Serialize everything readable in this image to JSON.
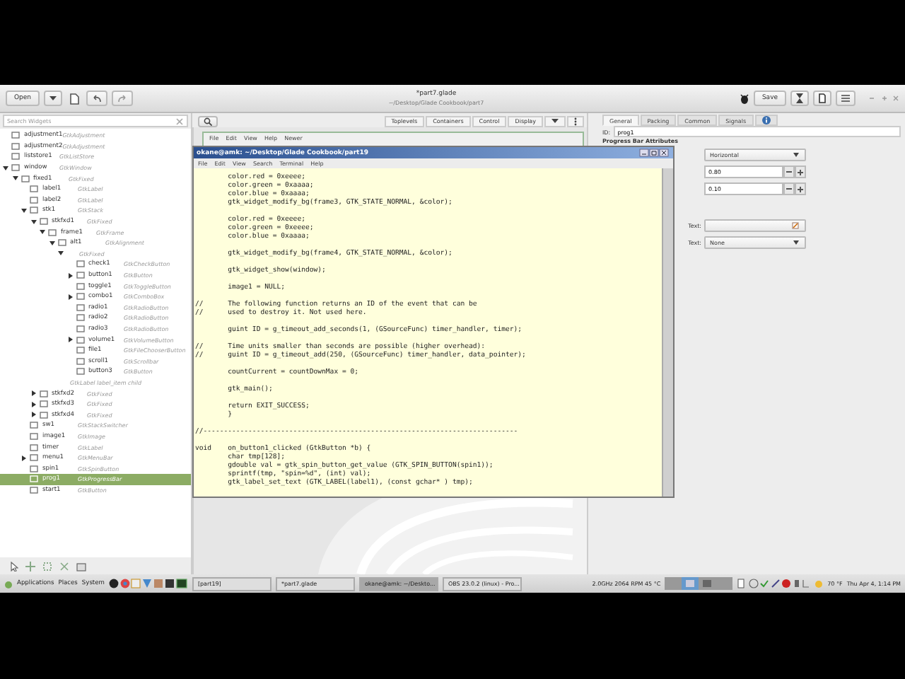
{
  "header": {
    "open_button": "Open",
    "title": "*part7.glade",
    "subtitle": "~/Desktop/Glade Cookbook/part7",
    "save_button": "Save"
  },
  "widget_search": {
    "placeholder": "Search Widgets"
  },
  "tree": [
    {
      "name": "adjustment1",
      "type": "GtkAdjustment",
      "kind": "leaf",
      "selected": false
    },
    {
      "name": "adjustment2",
      "type": "GtkAdjustment",
      "kind": "leaf",
      "selected": false
    },
    {
      "name": "liststore1",
      "type": "GtkListStore",
      "kind": "leaf",
      "selected": false
    },
    {
      "name": "window",
      "type": "GtkWindow",
      "kind": "group",
      "expanded": true,
      "selected": false,
      "children": [
        {
          "name": "fixed1",
          "type": "GtkFixed",
          "kind": "group",
          "expanded": true,
          "selected": false,
          "children": [
            {
              "name": "label1",
              "type": "GtkLabel",
              "kind": "leaf",
              "selected": false
            },
            {
              "name": "label2",
              "type": "GtkLabel",
              "kind": "leaf",
              "selected": false
            },
            {
              "name": "stk1",
              "type": "GtkStack",
              "kind": "group",
              "expanded": true,
              "selected": false,
              "children": [
                {
                  "name": "stkfxd1",
                  "type": "GtkFixed",
                  "kind": "group",
                  "expanded": true,
                  "selected": false,
                  "children": [
                    {
                      "name": "frame1",
                      "type": "GtkFrame",
                      "kind": "group",
                      "expanded": true,
                      "selected": false,
                      "children": [
                        {
                          "name": "alt1",
                          "type": "GtkAlignment",
                          "kind": "group",
                          "expanded": true,
                          "selected": false,
                          "children": [
                            {
                              "type": "GtkFixed",
                              "kind": "group",
                              "expanded": true,
                              "selected": false,
                              "children": [
                                {
                                  "name": "check1",
                                  "type": "GtkCheckButton",
                                  "kind": "leaf",
                                  "selected": false
                                },
                                {
                                  "name": "button1",
                                  "type": "GtkButton",
                                  "kind": "group",
                                  "expanded": false,
                                  "selected": false
                                },
                                {
                                  "name": "toggle1",
                                  "type": "GtkToggleButton",
                                  "kind": "leaf",
                                  "selected": false
                                },
                                {
                                  "name": "combo1",
                                  "type": "GtkComboBox",
                                  "kind": "group",
                                  "expanded": false,
                                  "selected": false
                                },
                                {
                                  "name": "radio1",
                                  "type": "GtkRadioButton",
                                  "kind": "leaf",
                                  "selected": false
                                },
                                {
                                  "name": "radio2",
                                  "type": "GtkRadioButton",
                                  "kind": "leaf",
                                  "selected": false
                                },
                                {
                                  "name": "radio3",
                                  "type": "GtkRadioButton",
                                  "kind": "leaf",
                                  "selected": false
                                },
                                {
                                  "name": "volume1",
                                  "type": "GtkVolumeButton",
                                  "kind": "group",
                                  "expanded": false,
                                  "selected": false
                                },
                                {
                                  "name": "file1",
                                  "type": "GtkFileChooserButton",
                                  "kind": "leaf",
                                  "selected": false
                                },
                                {
                                  "name": "scroll1",
                                  "type": "GtkScrollbar",
                                  "kind": "leaf",
                                  "selected": false
                                },
                                {
                                  "name": "button3",
                                  "type": "GtkButton",
                                  "kind": "leaf",
                                  "selected": false
                                }
                              ]
                            }
                          ]
                        },
                        {
                          "type": "GtkLabel label_item child",
                          "kind": "leaf",
                          "selected": false
                        }
                      ]
                    }
                  ]
                },
                {
                  "name": "stkfxd2",
                  "type": "GtkFixed",
                  "kind": "group",
                  "expanded": false,
                  "selected": false
                },
                {
                  "name": "stkfxd3",
                  "type": "GtkFixed",
                  "kind": "group",
                  "expanded": false,
                  "selected": false
                },
                {
                  "name": "stkfxd4",
                  "type": "GtkFixed",
                  "kind": "group",
                  "expanded": false,
                  "selected": false
                }
              ]
            },
            {
              "name": "sw1",
              "type": "GtkStackSwitcher",
              "kind": "leaf",
              "selected": false
            },
            {
              "name": "image1",
              "type": "GtkImage",
              "kind": "leaf",
              "selected": false
            },
            {
              "name": "timer",
              "type": "GtkLabel",
              "kind": "leaf",
              "selected": false
            },
            {
              "name": "menu1",
              "type": "GtkMenuBar",
              "kind": "group",
              "expanded": false,
              "selected": false
            },
            {
              "name": "spin1",
              "type": "GtkSpinButton",
              "kind": "leaf",
              "selected": false
            },
            {
              "name": "prog1",
              "type": "GtkProgressBar",
              "kind": "leaf",
              "selected": true
            },
            {
              "name": "start1",
              "type": "GtkButton",
              "kind": "leaf",
              "selected": false
            }
          ]
        }
      ]
    }
  ],
  "palette_tabs": [
    "Toplevels",
    "Containers",
    "Control",
    "Display"
  ],
  "preview_window": {
    "menu": [
      "File",
      "Edit",
      "View",
      "Help",
      "Newer"
    ]
  },
  "terminal": {
    "title": "okane@amk: ~/Desktop/Glade Cookbook/part19",
    "menu": [
      "File",
      "Edit",
      "View",
      "Search",
      "Terminal",
      "Help"
    ],
    "blocks": [
      [
        "        color.red = 0xeeee;",
        "        color.green = 0xaaaa;",
        "        color.blue = 0xaaaa;",
        "        gtk_widget_modify_bg(frame3, GTK_STATE_NORMAL, &color);"
      ],
      [
        "        color.red = 0xeeee;",
        "        color.green = 0xeeee;",
        "        color.blue = 0xaaaa;"
      ],
      [
        "        gtk_widget_modify_bg(frame4, GTK_STATE_NORMAL, &color);"
      ],
      [
        "        gtk_widget_show(window);"
      ],
      [
        "        image1 = NULL;"
      ],
      [
        "//      The following function returns an ID of the event that can be",
        "//      used to destroy it. Not used here."
      ],
      [
        "        guint ID = g_timeout_add_seconds(1, (GSourceFunc) timer_handler, timer);"
      ],
      [
        "//      Time units smaller than seconds are possible (higher overhead):",
        "//      guint ID = g_timeout_add(250, (GSourceFunc) timer_handler, data_pointer);"
      ],
      [
        "        countCurrent = countDownMax = 0;"
      ],
      [
        "        gtk_main();"
      ],
      [
        "        return EXIT_SUCCESS;",
        "        }"
      ],
      [
        "//-----------------------------------------------------------------------------"
      ],
      [
        "void    on_button1_clicked (GtkButton *b) {",
        "        char tmp[128];",
        "        gdouble val = gtk_spin_button_get_value (GTK_SPIN_BUTTON(spin1));",
        "        sprintf(tmp, \"spin=%d\", (int) val);",
        "        gtk_label_set_text (GTK_LABEL(label1), (const gchar* ) tmp);"
      ]
    ]
  },
  "inspector": {
    "tabs": [
      {
        "label": "General",
        "selected": true
      },
      {
        "label": "Packing",
        "selected": false
      },
      {
        "label": "Common",
        "selected": false
      },
      {
        "label": "Signals",
        "selected": false
      }
    ],
    "id_label": "ID:",
    "id_value": "prog1",
    "section": "Progress Bar Attributes",
    "orientation": "Horizontal",
    "fraction": "0.80",
    "pulse_step": "0.10",
    "text_label": "Text:",
    "ellipsize_label": "Text:",
    "ellipsize": "None"
  },
  "taskbar": {
    "menus": [
      "Applications",
      "Places",
      "System"
    ],
    "tasks": [
      {
        "label": "[part19]",
        "selected": false
      },
      {
        "label": "*part7.glade",
        "selected": false
      },
      {
        "label": "okane@amk: ~/Deskto...",
        "selected": true
      },
      {
        "label": "OBS 23.0.2 (linux) - Pro...",
        "selected": false
      }
    ],
    "sensors": "2.0GHz 2064 RPM 45 °C",
    "weather": "70 °F",
    "clock": "Thu Apr 4, 1:14 PM"
  }
}
